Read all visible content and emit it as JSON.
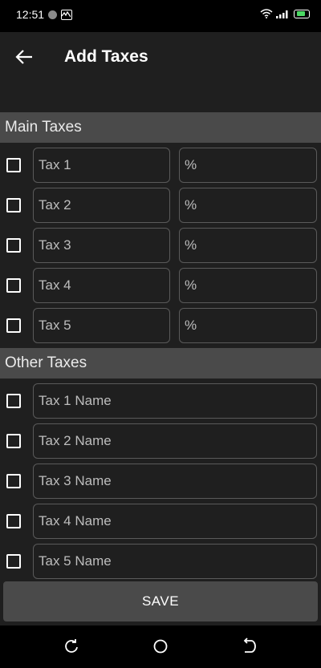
{
  "status_bar": {
    "time": "12:51",
    "battery_color": "#4cd964"
  },
  "header": {
    "title": "Add Taxes",
    "back_icon": "arrow-left-icon"
  },
  "main_taxes": {
    "title": "Main Taxes",
    "rows": [
      {
        "name_placeholder": "Tax 1",
        "percent_placeholder": "%"
      },
      {
        "name_placeholder": "Tax 2",
        "percent_placeholder": "%"
      },
      {
        "name_placeholder": "Tax 3",
        "percent_placeholder": "%"
      },
      {
        "name_placeholder": "Tax 4",
        "percent_placeholder": "%"
      },
      {
        "name_placeholder": "Tax 5",
        "percent_placeholder": "%"
      }
    ]
  },
  "other_taxes": {
    "title": "Other Taxes",
    "rows": [
      {
        "name_placeholder": "Tax 1 Name"
      },
      {
        "name_placeholder": "Tax 2 Name"
      },
      {
        "name_placeholder": "Tax 3 Name"
      },
      {
        "name_placeholder": "Tax 4 Name"
      },
      {
        "name_placeholder": "Tax 5 Name"
      }
    ]
  },
  "actions": {
    "save_label": "SAVE"
  },
  "nav": {
    "recents_icon": "recents-icon",
    "home_icon": "home-icon",
    "back_icon": "back-icon"
  },
  "colors": {
    "background": "#1f1f1f",
    "section_header": "#4a4a4a",
    "field_border": "#5a5a5a",
    "text": "#ffffff"
  }
}
